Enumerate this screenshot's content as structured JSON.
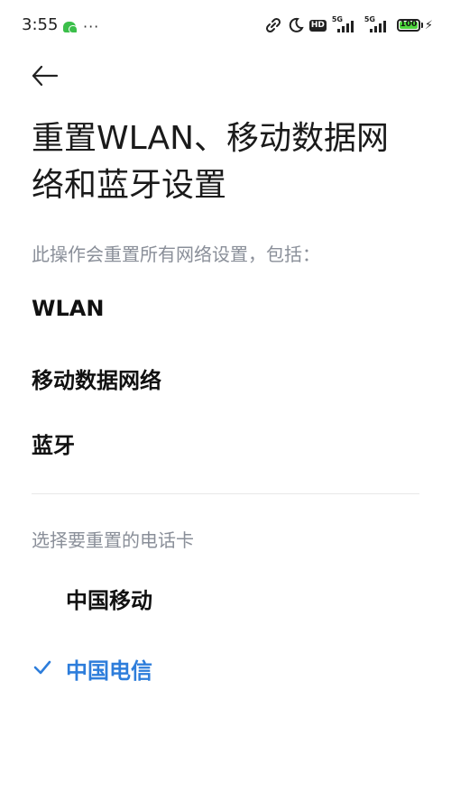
{
  "status_bar": {
    "time": "3:55",
    "dots": "···",
    "hd_label": "HD",
    "net1_label": "5G",
    "net2_label": "5G",
    "battery_level": "100"
  },
  "header": {
    "back_icon": "arrow-left-icon",
    "title": "重置WLAN、移动数据网络和蓝牙设置"
  },
  "content": {
    "subtitle": "此操作会重置所有网络设置，包括：",
    "items": [
      "WLAN",
      "移动数据网络",
      "蓝牙"
    ],
    "sim_section_label": "选择要重置的电话卡",
    "sim_options": [
      {
        "label": "中国移动",
        "selected": false
      },
      {
        "label": "中国电信",
        "selected": true
      }
    ]
  },
  "colors": {
    "accent": "#2d7ddb",
    "secondary_text": "#8a8f99",
    "primary_text": "#111111",
    "battery_fill": "#4cd53c"
  }
}
